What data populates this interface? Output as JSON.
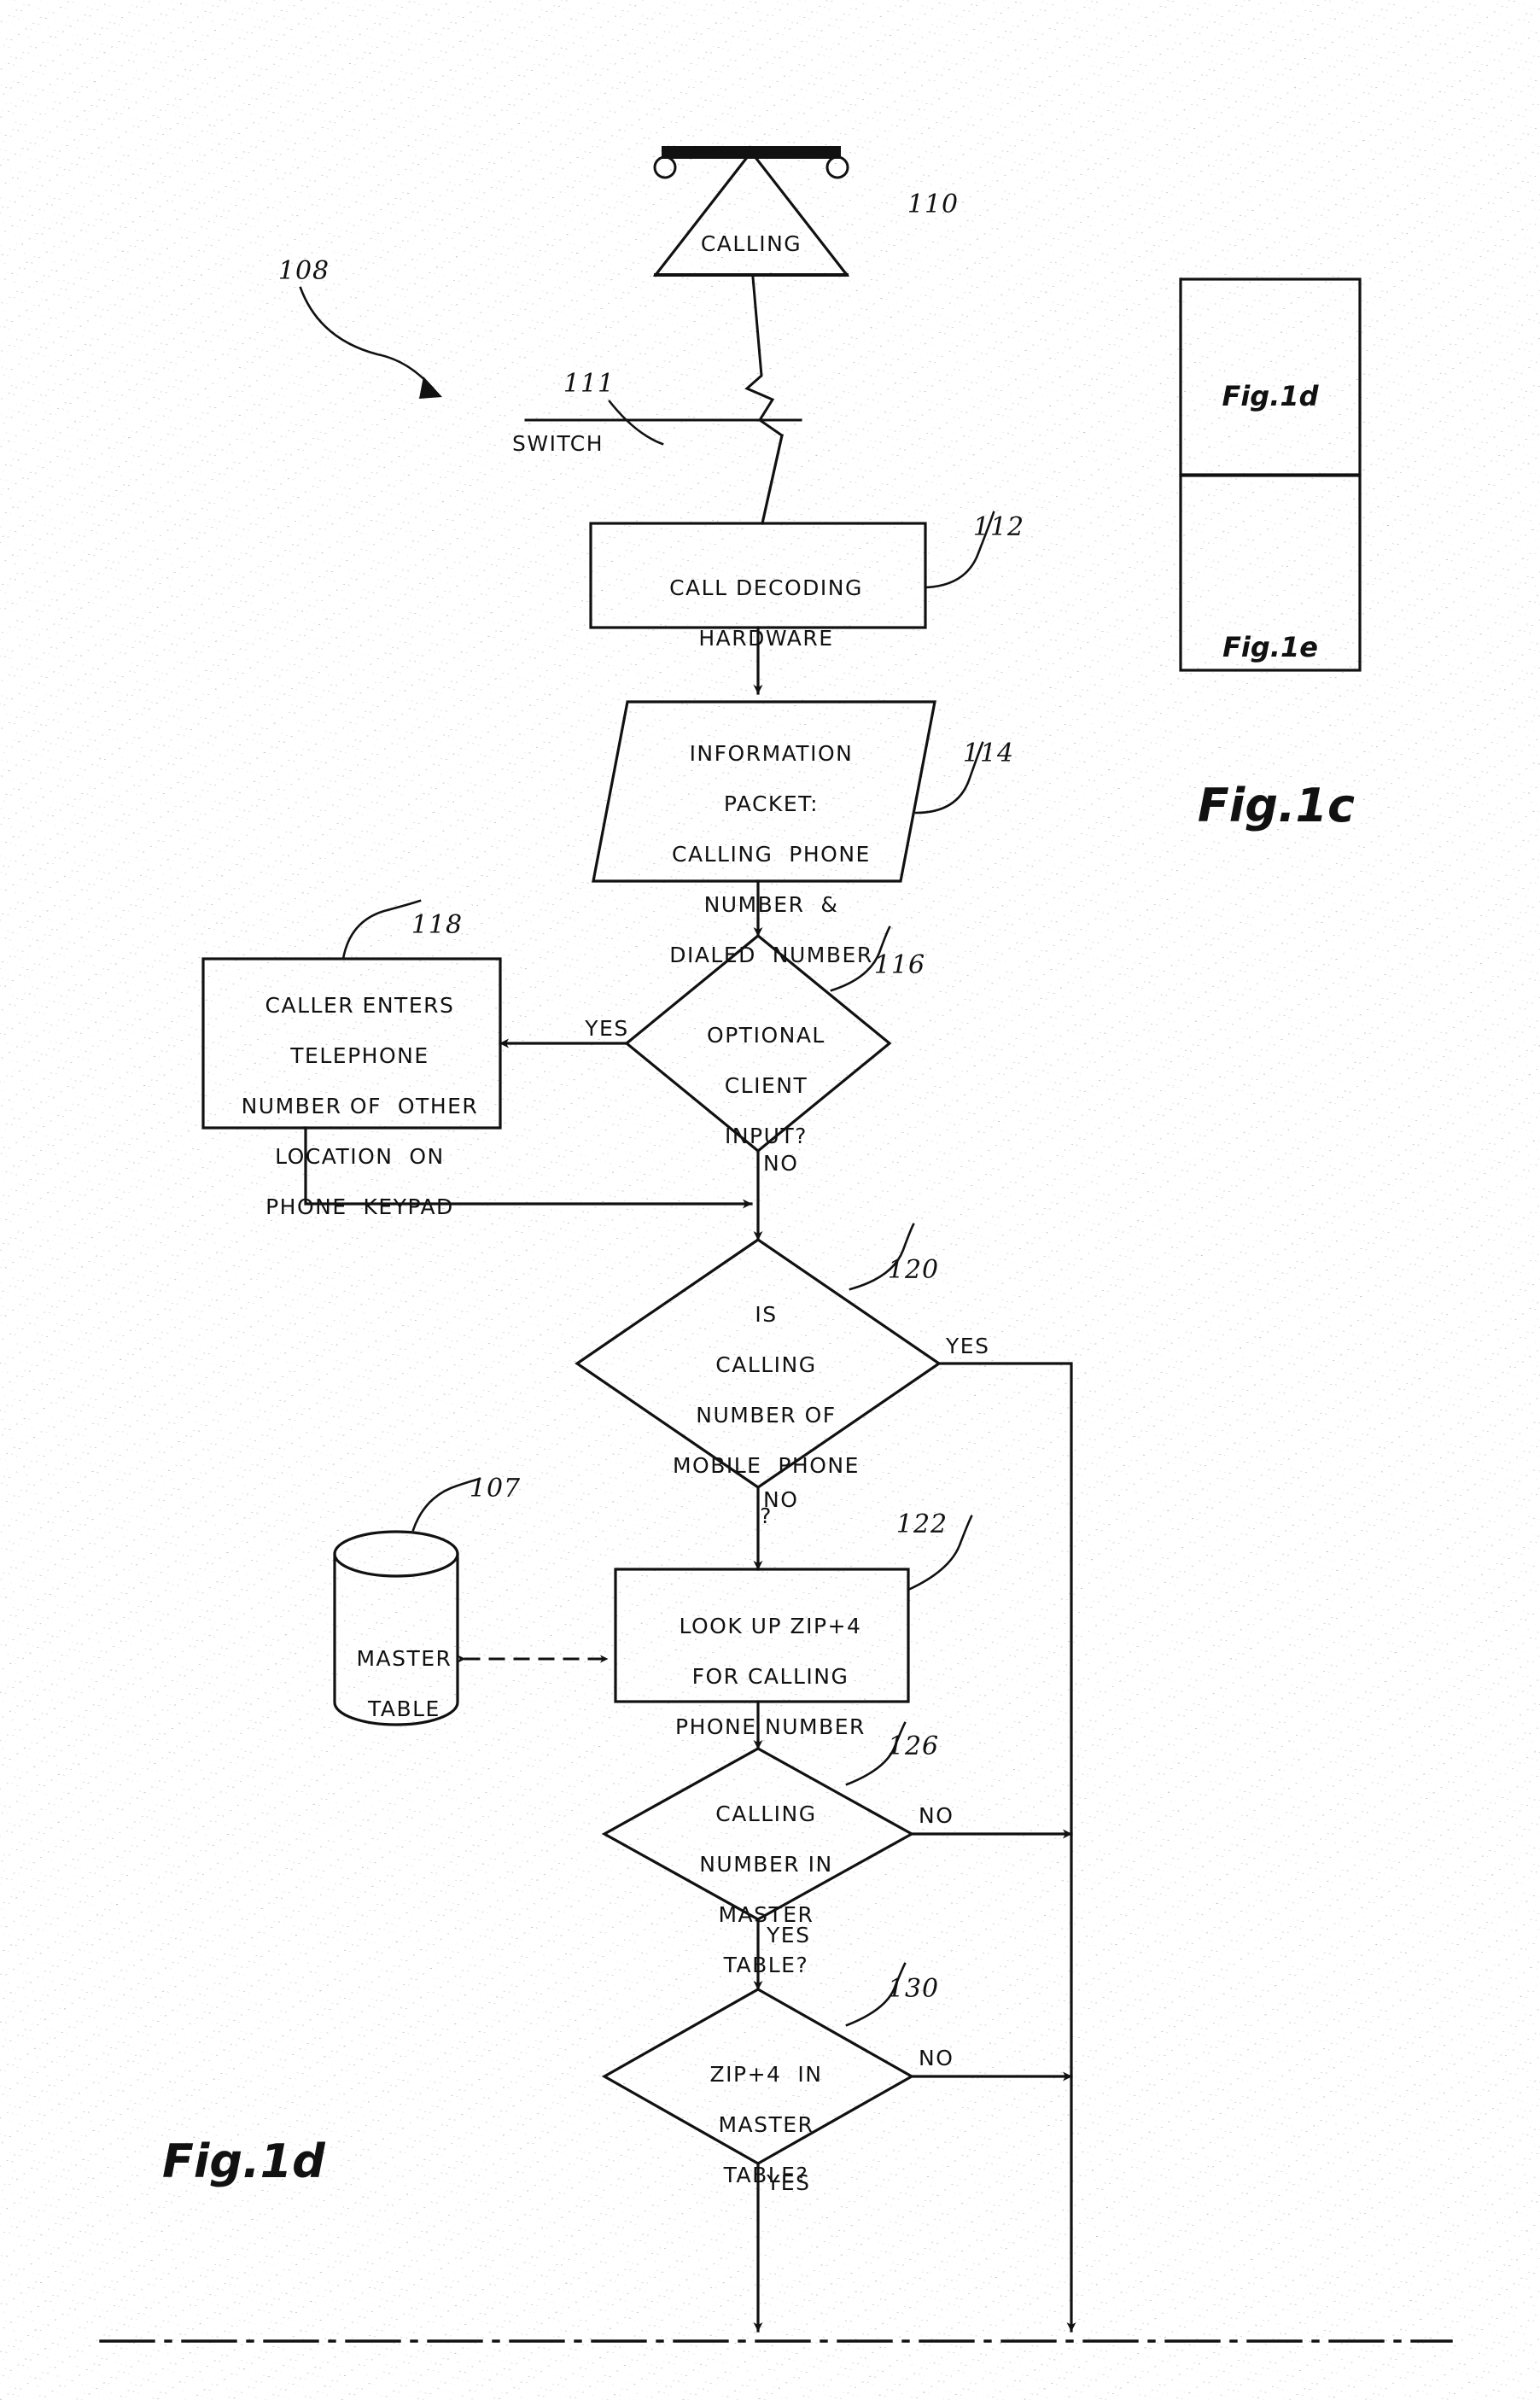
{
  "figure": {
    "main_caption": "Fig.1d",
    "key_caption": "Fig.1c",
    "key_boxes": [
      {
        "label": "Fig.1d"
      },
      {
        "label": "Fig.1e"
      }
    ]
  },
  "reference_numerals": {
    "system": "108",
    "switch_line": "111",
    "calling_phone": "110",
    "call_decoding_hardware": "112",
    "information_packet": "114",
    "optional_client_input": "116",
    "caller_enters": "118",
    "is_mobile_phone": "120",
    "look_up_zip": "122",
    "master_table": "107",
    "calling_number_in_table": "126",
    "zip_in_table": "130"
  },
  "nodes": {
    "calling": {
      "label": "CALLING",
      "shape": "antenna-triangle"
    },
    "switch_label": {
      "label": "SWITCH"
    },
    "call_decoding": {
      "lines": [
        "CALL DECODING",
        "HARDWARE"
      ],
      "shape": "rect"
    },
    "information_packet": {
      "lines": [
        "INFORMATION",
        "PACKET:",
        "CALLING  PHONE",
        "NUMBER  &",
        "DIALED  NUMBER"
      ],
      "shape": "parallelogram"
    },
    "optional_client_input": {
      "lines": [
        "OPTIONAL",
        "CLIENT",
        "INPUT?"
      ],
      "shape": "diamond"
    },
    "caller_enters": {
      "lines": [
        "CALLER ENTERS",
        "TELEPHONE",
        "NUMBER OF  OTHER",
        "LOCATION  ON",
        "PHONE  KEYPAD"
      ],
      "shape": "rect"
    },
    "is_mobile": {
      "lines": [
        "IS",
        "CALLING",
        "NUMBER OF",
        "MOBILE  PHONE",
        "?"
      ],
      "shape": "diamond"
    },
    "master_table": {
      "lines": [
        "MASTER",
        "TABLE"
      ],
      "shape": "cylinder"
    },
    "look_up_zip": {
      "lines": [
        "LOOK UP ZIP+4",
        "FOR CALLING",
        "PHONE NUMBER"
      ],
      "shape": "rect"
    },
    "calling_number_in_table": {
      "lines": [
        "CALLING",
        "NUMBER IN",
        "MASTER",
        "TABLE?"
      ],
      "shape": "diamond"
    },
    "zip_in_table": {
      "lines": [
        "ZIP+4  IN",
        "MASTER",
        "TABLE?"
      ],
      "shape": "diamond"
    }
  },
  "edge_labels": {
    "optional_yes": "YES",
    "optional_no": "NO",
    "mobile_yes": "YES",
    "mobile_no": "NO",
    "number_in_table_no": "NO",
    "number_in_table_yes": "YES",
    "zip_in_table_no": "NO",
    "zip_in_table_yes": "YES"
  },
  "colors": {
    "ink": "#111111",
    "paper": "#ffffff"
  }
}
